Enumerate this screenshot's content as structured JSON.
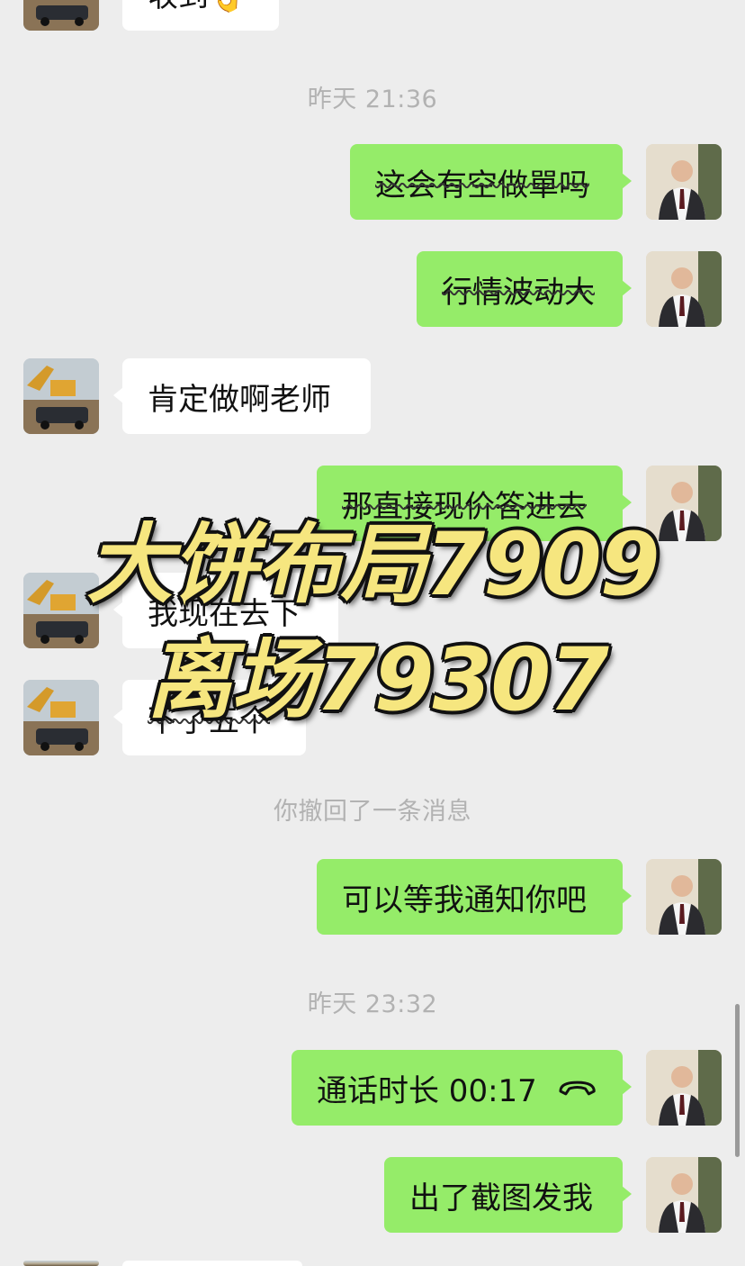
{
  "messages": {
    "top_partial_text": "收到👌",
    "ts1": "昨天 21:36",
    "m1": "这会有空做單吗",
    "m2": "行情波动大",
    "m3": "肯定做啊老师",
    "m4": "那直接现价答进去",
    "m5": "我现在去下",
    "m6": "下了五个",
    "system": "你撤回了一条消息",
    "m7": "可以等我通知你吧",
    "ts2": "昨天 23:32",
    "call_text": "通话时长 00:17",
    "m8": "出了截图发我"
  },
  "overlay": {
    "line1": "大饼布局7909",
    "line2": "离场79307"
  },
  "colors": {
    "background": "#ededed",
    "outgoing_bubble": "#95ec69",
    "incoming_bubble": "#ffffff",
    "timestamp": "#b2b2b2",
    "overlay_text": "#f6e67f"
  },
  "icons": {
    "call": "phone-hangup-icon",
    "avatar_self": "man-in-suit-avatar",
    "avatar_other": "excavator-car-avatar"
  }
}
